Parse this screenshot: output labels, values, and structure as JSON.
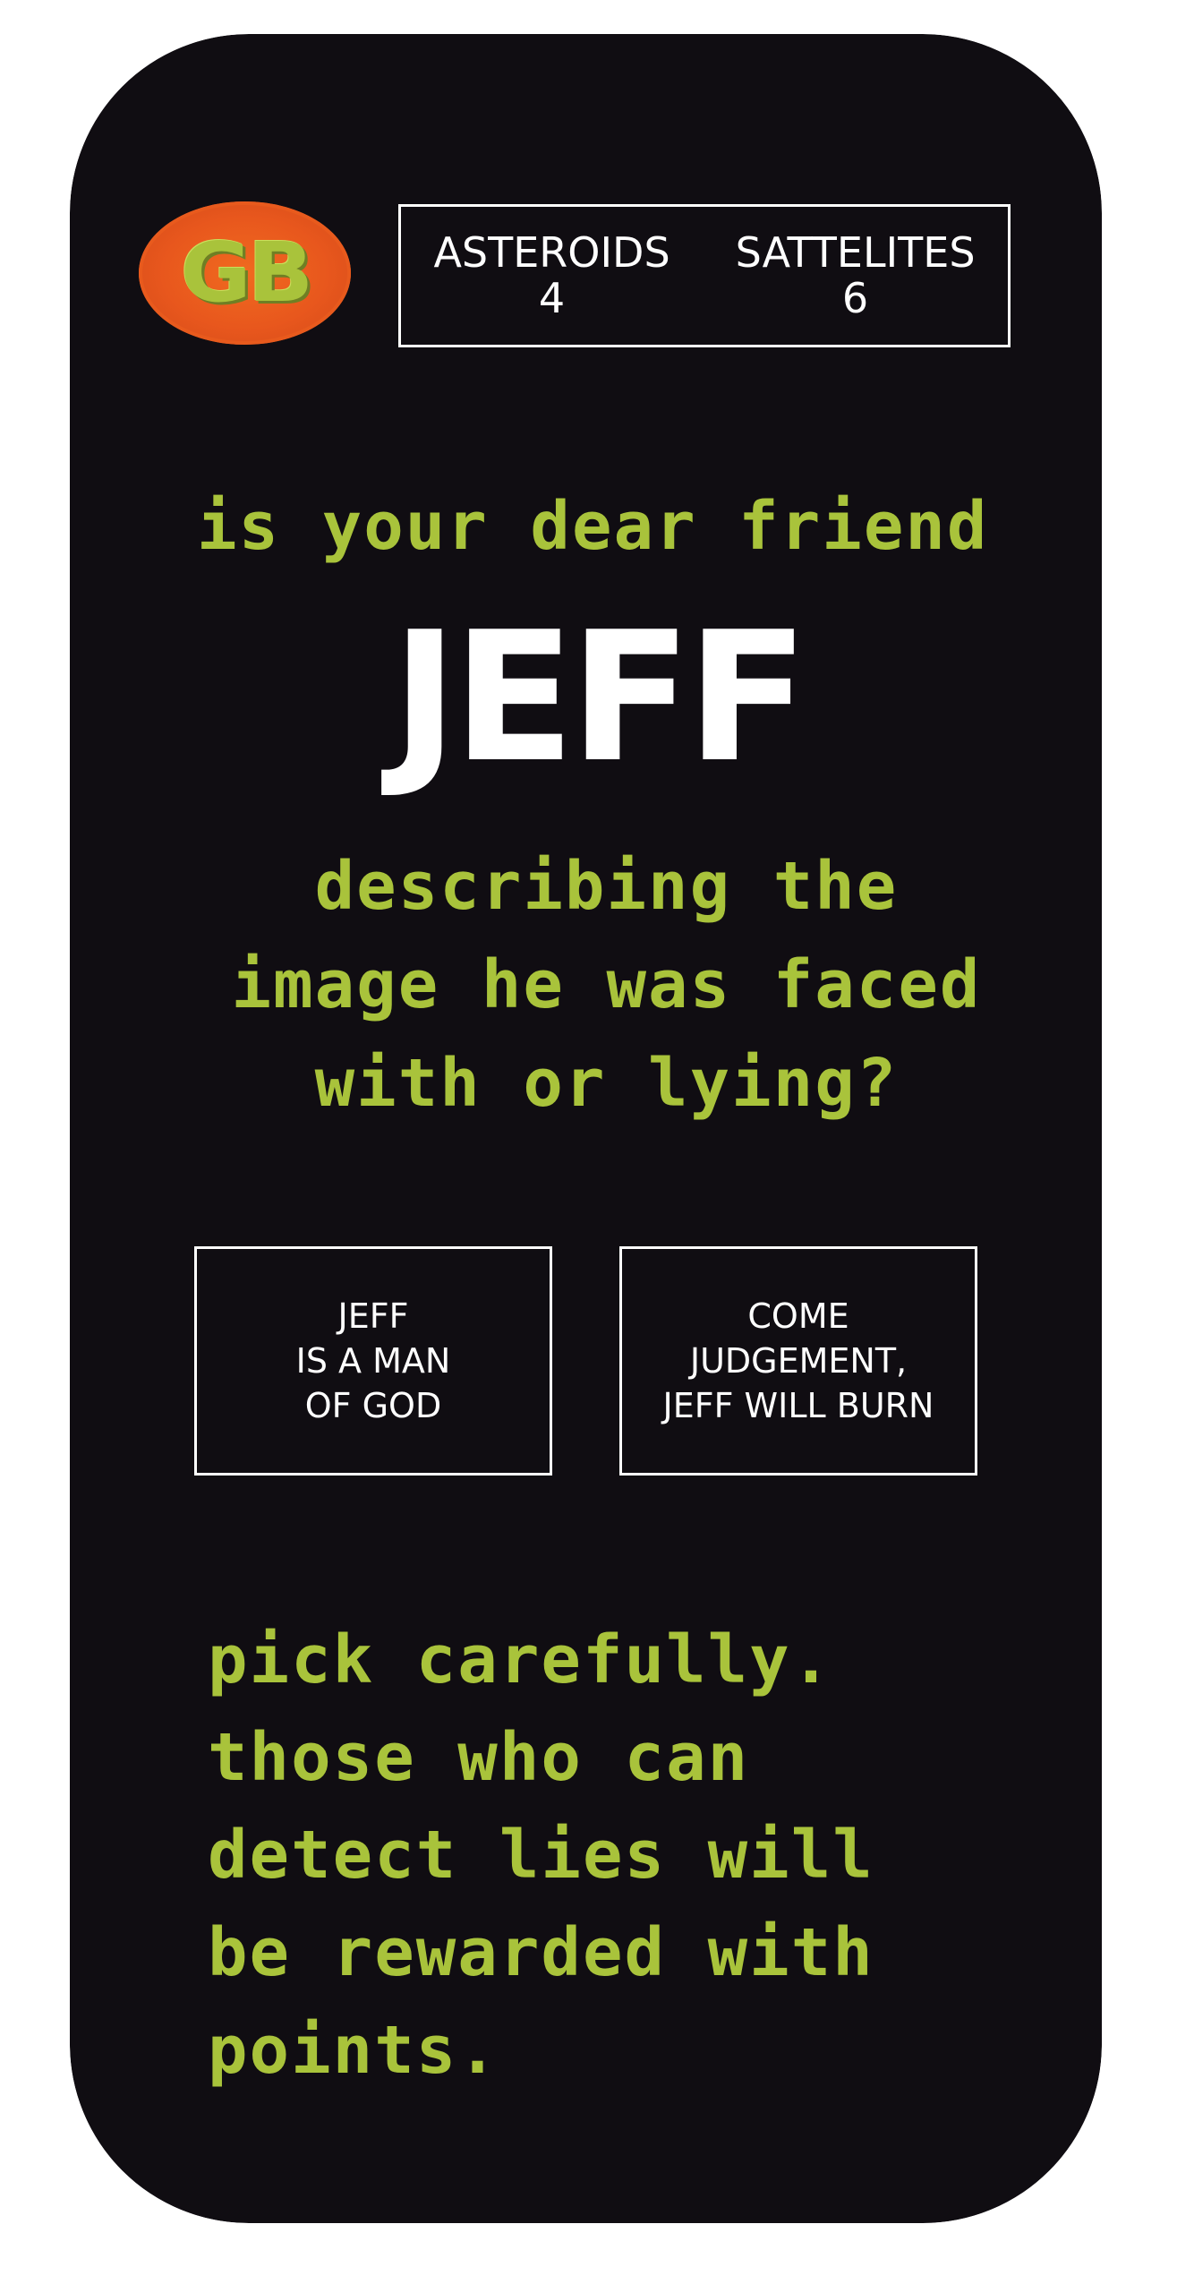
{
  "logo": {
    "text": "GB",
    "color": "#a9c33b",
    "background": "#e8571d"
  },
  "score": {
    "asteroids_label": "ASTEROIDS",
    "asteroids_value": "4",
    "satellites_label": "SATTELITES",
    "satellites_value": "6"
  },
  "prompt": {
    "intro": "is your dear friend",
    "name": "JEFF",
    "question_lines": [
      "describing the",
      "image he was faced",
      "with or lying?"
    ]
  },
  "choices": {
    "left_label": "JEFF\nIS A MAN\nOF GOD",
    "right_label": "COME\nJUDGEMENT,\nJEFF WILL BURN"
  },
  "footer": {
    "lines": [
      "pick carefully.",
      "those who can",
      "detect lies will",
      "be rewarded with",
      "points."
    ]
  },
  "colors": {
    "background": "#100d12",
    "accent_green": "#a9c33b",
    "logo_orange": "#e8571d",
    "text_white": "#ffffff"
  }
}
